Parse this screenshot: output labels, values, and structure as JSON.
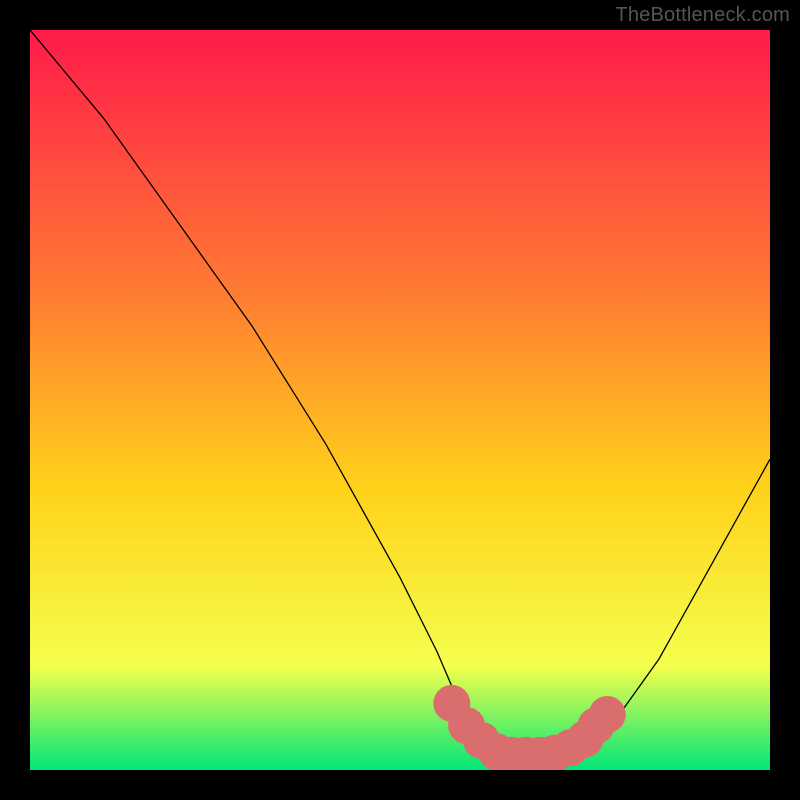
{
  "watermark": "TheBottleneck.com",
  "colors": {
    "frame_background": "#000000",
    "gradient_top": "#ff1a4a",
    "gradient_upper_mid": "#ff7a33",
    "gradient_mid": "#ffd21a",
    "gradient_lower": "#f4ff4d",
    "gradient_bottom": "#00e676",
    "curve_stroke": "#000000",
    "marker_fill": "#da6e6e"
  },
  "chart_data": {
    "type": "line",
    "title": "",
    "xlabel": "",
    "ylabel": "",
    "xlim": [
      0,
      100
    ],
    "ylim": [
      0,
      100
    ],
    "series": [
      {
        "name": "curve",
        "x": [
          0,
          5,
          10,
          15,
          20,
          25,
          30,
          35,
          40,
          45,
          50,
          55,
          58,
          60,
          63,
          66,
          70,
          73,
          76,
          80,
          85,
          90,
          95,
          100
        ],
        "values": [
          100,
          94,
          88,
          81,
          74,
          67,
          60,
          52,
          44,
          35,
          26,
          16,
          9,
          6,
          3,
          2,
          2,
          2,
          4,
          8,
          15,
          24,
          33,
          42
        ]
      }
    ],
    "marker_cluster": {
      "note": "red blob of markers at the bottom of the valley",
      "points": [
        {
          "x": 57,
          "y": 9
        },
        {
          "x": 59,
          "y": 6
        },
        {
          "x": 61,
          "y": 4
        },
        {
          "x": 63,
          "y": 2.5
        },
        {
          "x": 65,
          "y": 2
        },
        {
          "x": 67,
          "y": 2
        },
        {
          "x": 69,
          "y": 2
        },
        {
          "x": 71,
          "y": 2.3
        },
        {
          "x": 73,
          "y": 3
        },
        {
          "x": 75,
          "y": 4.2
        },
        {
          "x": 76.5,
          "y": 6
        },
        {
          "x": 78,
          "y": 7.5
        }
      ],
      "radius": 2.5
    }
  }
}
